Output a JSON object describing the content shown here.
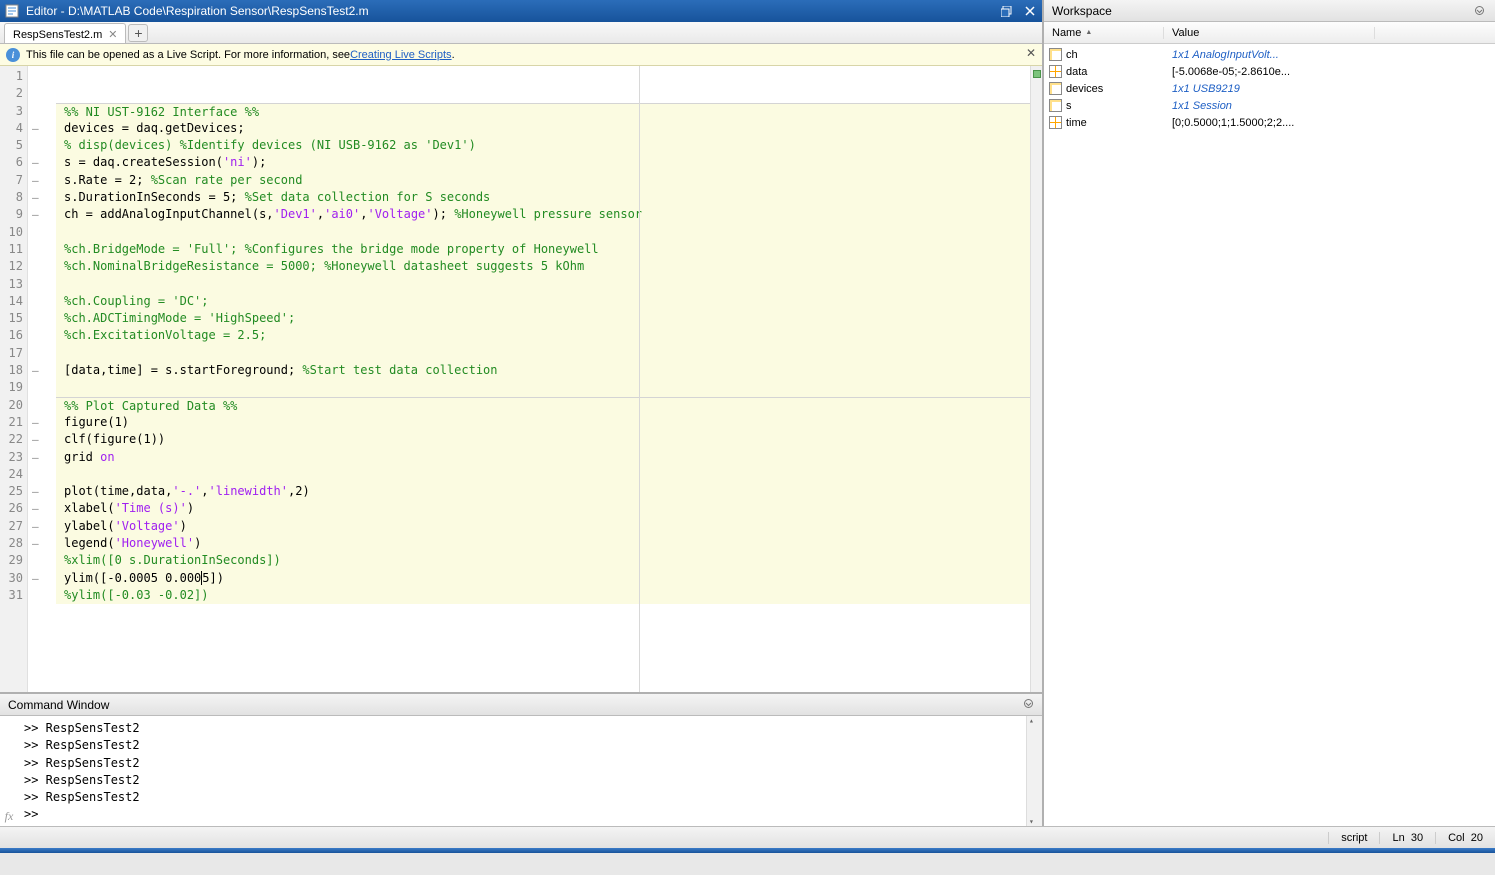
{
  "editor": {
    "title_prefix": "Editor - ",
    "filepath": "D:\\MATLAB Code\\Respiration Sensor\\RespSensTest2.m",
    "tab_name": "RespSensTest2.m",
    "notice_text": "This file can be opened as a Live Script. For more information, see ",
    "notice_link": "Creating Live Scripts",
    "line_count": 31,
    "fold_marks": {
      "4": "–",
      "6": "–",
      "7": "–",
      "8": "–",
      "9": "–",
      "18": "–",
      "21": "–",
      "22": "–",
      "23": "–",
      "25": "–",
      "26": "–",
      "27": "–",
      "28": "–",
      "30": "–"
    }
  },
  "code_lines": [
    {
      "n": 1,
      "sec": 0,
      "tokens": []
    },
    {
      "n": 2,
      "sec": 0,
      "tokens": []
    },
    {
      "n": 3,
      "sec": 1,
      "top": 1,
      "tokens": [
        {
          "c": "comment",
          "t": "%% NI UST-9162 Interface %%"
        }
      ]
    },
    {
      "n": 4,
      "sec": 1,
      "tokens": [
        {
          "c": "black",
          "t": "devices = daq.getDevices;"
        }
      ]
    },
    {
      "n": 5,
      "sec": 1,
      "tokens": [
        {
          "c": "comment",
          "t": "% disp(devices) %Identify devices (NI USB-9162 as 'Dev1')"
        }
      ]
    },
    {
      "n": 6,
      "sec": 1,
      "tokens": [
        {
          "c": "black",
          "t": "s = daq.createSession("
        },
        {
          "c": "string",
          "t": "'ni'"
        },
        {
          "c": "black",
          "t": ");"
        }
      ]
    },
    {
      "n": 7,
      "sec": 1,
      "tokens": [
        {
          "c": "black",
          "t": "s.Rate = 2; "
        },
        {
          "c": "comment",
          "t": "%Scan rate per second"
        }
      ]
    },
    {
      "n": 8,
      "sec": 1,
      "tokens": [
        {
          "c": "black",
          "t": "s.DurationInSeconds = 5; "
        },
        {
          "c": "comment",
          "t": "%Set data collection for S seconds"
        }
      ]
    },
    {
      "n": 9,
      "sec": 1,
      "tokens": [
        {
          "c": "black",
          "t": "ch = addAnalogInputChannel(s,"
        },
        {
          "c": "string",
          "t": "'Dev1'"
        },
        {
          "c": "black",
          "t": ","
        },
        {
          "c": "string",
          "t": "'ai0'"
        },
        {
          "c": "black",
          "t": ","
        },
        {
          "c": "string",
          "t": "'Voltage'"
        },
        {
          "c": "black",
          "t": "); "
        },
        {
          "c": "comment",
          "t": "%Honeywell pressure sensor"
        }
      ]
    },
    {
      "n": 10,
      "sec": 1,
      "tokens": []
    },
    {
      "n": 11,
      "sec": 1,
      "tokens": [
        {
          "c": "comment",
          "t": "%ch.BridgeMode = 'Full'; %Configures the bridge mode property of Honeywell"
        }
      ]
    },
    {
      "n": 12,
      "sec": 1,
      "tokens": [
        {
          "c": "comment",
          "t": "%ch.NominalBridgeResistance = 5000; %Honeywell datasheet suggests 5 kOhm"
        }
      ]
    },
    {
      "n": 13,
      "sec": 1,
      "tokens": []
    },
    {
      "n": 14,
      "sec": 1,
      "tokens": [
        {
          "c": "comment",
          "t": "%ch.Coupling = 'DC';"
        }
      ]
    },
    {
      "n": 15,
      "sec": 1,
      "tokens": [
        {
          "c": "comment",
          "t": "%ch.ADCTimingMode = 'HighSpeed';"
        }
      ]
    },
    {
      "n": 16,
      "sec": 1,
      "tokens": [
        {
          "c": "comment",
          "t": "%ch.ExcitationVoltage = 2.5;"
        }
      ]
    },
    {
      "n": 17,
      "sec": 1,
      "tokens": []
    },
    {
      "n": 18,
      "sec": 1,
      "tokens": [
        {
          "c": "black",
          "t": "[data,time] = s.startForeground; "
        },
        {
          "c": "comment",
          "t": "%Start test data collection"
        }
      ]
    },
    {
      "n": 19,
      "sec": 1,
      "tokens": []
    },
    {
      "n": 20,
      "sec": 2,
      "top": 1,
      "tokens": [
        {
          "c": "comment",
          "t": "%% Plot Captured Data %%"
        }
      ]
    },
    {
      "n": 21,
      "sec": 2,
      "tokens": [
        {
          "c": "black",
          "t": "figure(1)"
        }
      ]
    },
    {
      "n": 22,
      "sec": 2,
      "tokens": [
        {
          "c": "black",
          "t": "clf(figure(1))"
        }
      ]
    },
    {
      "n": 23,
      "sec": 2,
      "tokens": [
        {
          "c": "black",
          "t": "grid "
        },
        {
          "c": "string",
          "t": "on"
        }
      ]
    },
    {
      "n": 24,
      "sec": 2,
      "tokens": []
    },
    {
      "n": 25,
      "sec": 2,
      "tokens": [
        {
          "c": "black",
          "t": "plot(time,data,"
        },
        {
          "c": "string",
          "t": "'-.'"
        },
        {
          "c": "black",
          "t": ","
        },
        {
          "c": "string",
          "t": "'linewidth'"
        },
        {
          "c": "black",
          "t": ",2)"
        }
      ]
    },
    {
      "n": 26,
      "sec": 2,
      "tokens": [
        {
          "c": "black",
          "t": "xlabel("
        },
        {
          "c": "string",
          "t": "'Time (s)'"
        },
        {
          "c": "black",
          "t": ")"
        }
      ]
    },
    {
      "n": 27,
      "sec": 2,
      "tokens": [
        {
          "c": "black",
          "t": "ylabel("
        },
        {
          "c": "string",
          "t": "'Voltage'"
        },
        {
          "c": "black",
          "t": ")"
        }
      ]
    },
    {
      "n": 28,
      "sec": 2,
      "tokens": [
        {
          "c": "black",
          "t": "legend("
        },
        {
          "c": "string",
          "t": "'Honeywell'"
        },
        {
          "c": "black",
          "t": ")"
        }
      ]
    },
    {
      "n": 29,
      "sec": 2,
      "tokens": [
        {
          "c": "comment",
          "t": "%xlim([0 s.DurationInSeconds])"
        }
      ]
    },
    {
      "n": 30,
      "sec": 2,
      "caret": 19,
      "tokens": [
        {
          "c": "black",
          "t": "ylim([-0.0005 0.0005])"
        }
      ]
    },
    {
      "n": 31,
      "sec": 2,
      "tokens": [
        {
          "c": "comment",
          "t": "%ylim([-0.03 -0.02])"
        }
      ]
    }
  ],
  "command_window": {
    "title": "Command Window",
    "lines": [
      ">> RespSensTest2",
      ">> RespSensTest2",
      ">> RespSensTest2",
      ">> RespSensTest2",
      ">> RespSensTest2"
    ],
    "prompt": ">> ",
    "fx": "fx"
  },
  "workspace": {
    "title": "Workspace",
    "col_name": "Name",
    "col_value": "Value",
    "vars": [
      {
        "icon": "box",
        "name": "ch",
        "value": "1x1 AnalogInputVolt...",
        "link": true
      },
      {
        "icon": "grid",
        "name": "data",
        "value": "[-5.0068e-05;-2.8610e...",
        "link": false
      },
      {
        "icon": "box",
        "name": "devices",
        "value": "1x1 USB9219",
        "link": true
      },
      {
        "icon": "box",
        "name": "s",
        "value": "1x1 Session",
        "link": true
      },
      {
        "icon": "grid",
        "name": "time",
        "value": "[0;0.5000;1;1.5000;2;2....",
        "link": false
      }
    ]
  },
  "status": {
    "mode": "script",
    "ln_label": "Ln",
    "ln": "30",
    "col_label": "Col",
    "col": "20"
  }
}
